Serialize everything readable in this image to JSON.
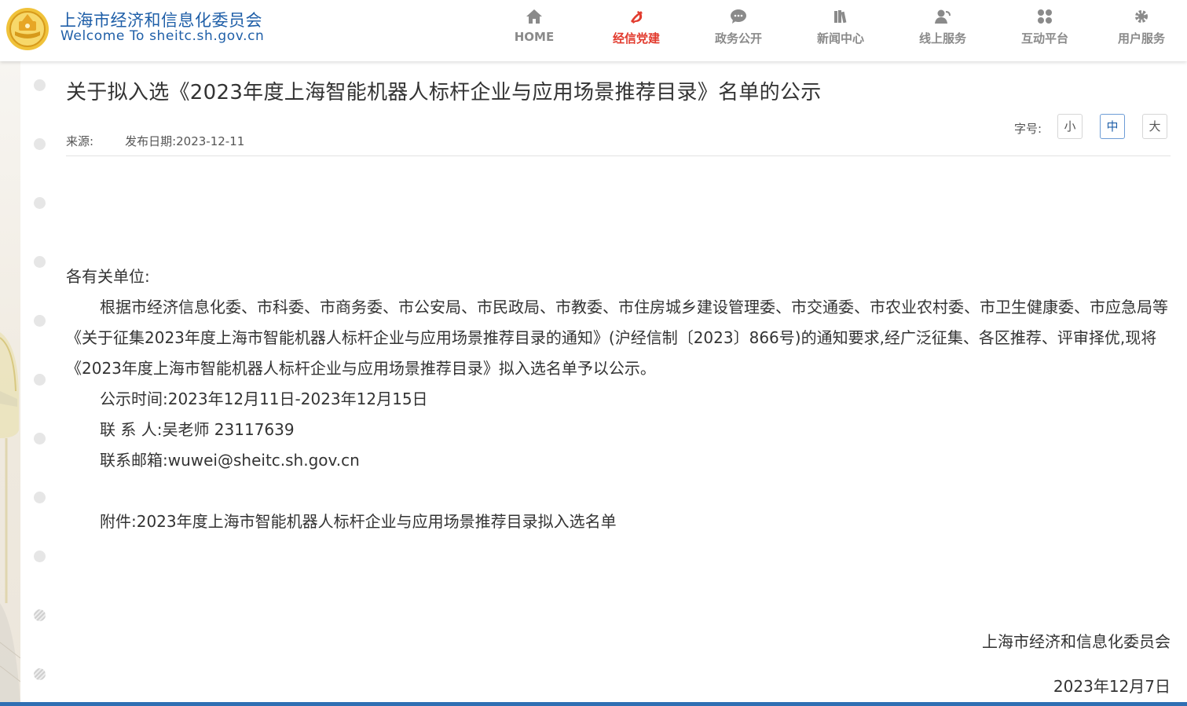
{
  "header": {
    "site_name": "上海市经济和信息化委员会",
    "site_sub": "Welcome To sheitc.sh.gov.cn",
    "logo_icon": "emblem-icon",
    "accent_color": "#1f5fa8",
    "active_color": "#e23b2e"
  },
  "nav": [
    {
      "label": "HOME",
      "icon": "home-icon"
    },
    {
      "label": "经信党建",
      "icon": "party-emblem-icon"
    },
    {
      "label": "政务公开",
      "icon": "chat-bubble-icon"
    },
    {
      "label": "新闻中心",
      "icon": "books-icon"
    },
    {
      "label": "线上服务",
      "icon": "user-service-icon"
    },
    {
      "label": "互动平台",
      "icon": "grid-icon"
    },
    {
      "label": "用户服务",
      "icon": "gear-icon"
    }
  ],
  "article": {
    "title": "关于拟入选《2023年度上海智能机器人标杆企业与应用场景推荐目录》名单的公示",
    "source_label": "来源:",
    "date_label": "发布日期:2023-12-11",
    "font_size_label": "字号:",
    "font_sizes": [
      "小",
      "中",
      "大"
    ],
    "salutation": "各有关单位:",
    "paragraph": "根据市经济信息化委、市科委、市商务委、市公安局、市民政局、市教委、市住房城乡建设管理委、市交通委、市农业农村委、市卫生健康委、市应急局等《关于征集2023年度上海市智能机器人标杆企业与应用场景推荐目录的通知》(沪经信制〔2023〕866号)的通知要求,经广泛征集、各区推荐、评审择优,现将《2023年度上海市智能机器人标杆企业与应用场景推荐目录》拟入选名单予以公示。",
    "time_line": "公示时间:2023年12月11日-2023年12月15日",
    "contact_line": "联 系 人:吴老师 23117639",
    "email_line": "联系邮箱:wuwei@sheitc.sh.gov.cn",
    "attachment_line": "附件:2023年度上海市智能机器人标杆企业与应用场景推荐目录拟入选名单",
    "signature": "上海市经济和信息化委员会",
    "sign_date": "2023年12月7日"
  }
}
